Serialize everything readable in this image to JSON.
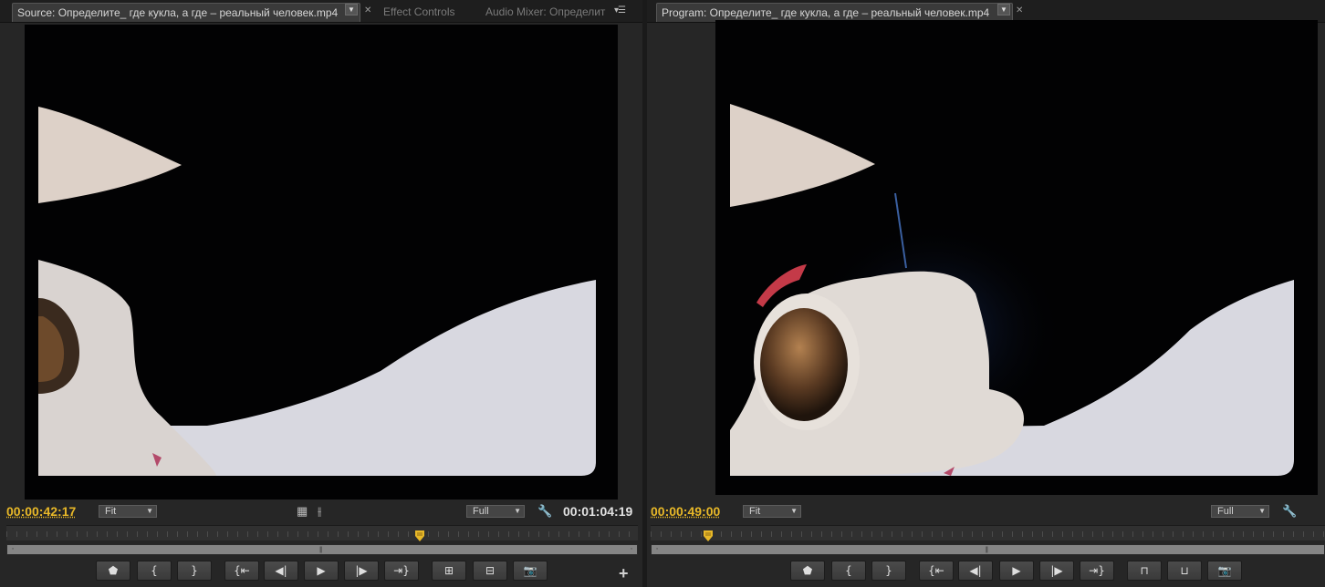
{
  "source": {
    "tabs": [
      {
        "label": "Source: Определите_ где кукла, а где – реальный человек.mp4",
        "active": true
      },
      {
        "label": "Effect Controls",
        "active": false
      },
      {
        "label": "Audio Mixer: Определит",
        "active": false
      }
    ],
    "current_timecode": "00:00:42:17",
    "duration_timecode": "00:01:04:19",
    "zoom_select": "Fit",
    "resolution_select": "Full",
    "playhead_progress": 0.655,
    "buttons": [
      {
        "name": "add-marker",
        "icon": "marker-icon",
        "glyph": "⬟"
      },
      {
        "name": "mark-in",
        "icon": "mark-in-icon",
        "glyph": "{"
      },
      {
        "name": "mark-out",
        "icon": "mark-out-icon",
        "glyph": "}"
      },
      {
        "name": "go-to-in",
        "icon": "go-to-in-icon",
        "glyph": "{⇤"
      },
      {
        "name": "step-back",
        "icon": "step-back-icon",
        "glyph": "◀|"
      },
      {
        "name": "play",
        "icon": "play-icon",
        "glyph": "▶"
      },
      {
        "name": "step-forward",
        "icon": "step-forward-icon",
        "glyph": "|▶"
      },
      {
        "name": "go-to-out",
        "icon": "go-to-out-icon",
        "glyph": "⇥}"
      },
      {
        "name": "insert",
        "icon": "insert-icon",
        "glyph": "⊞"
      },
      {
        "name": "overwrite",
        "icon": "overwrite-icon",
        "glyph": "⊟"
      },
      {
        "name": "export-frame",
        "icon": "camera-icon",
        "glyph": "📷"
      }
    ]
  },
  "program": {
    "tabs": [
      {
        "label": "Program: Определите_ где кукла, а где – реальный человек.mp4",
        "active": true
      }
    ],
    "current_timecode": "00:00:49:00",
    "zoom_select": "Fit",
    "resolution_select": "Full",
    "playhead_progress": 0.085,
    "buttons": [
      {
        "name": "add-marker",
        "icon": "marker-icon",
        "glyph": "⬟"
      },
      {
        "name": "mark-in",
        "icon": "mark-in-icon",
        "glyph": "{"
      },
      {
        "name": "mark-out",
        "icon": "mark-out-icon",
        "glyph": "}"
      },
      {
        "name": "go-to-in",
        "icon": "go-to-in-icon",
        "glyph": "{⇤"
      },
      {
        "name": "step-back",
        "icon": "step-back-icon",
        "glyph": "◀|"
      },
      {
        "name": "play",
        "icon": "play-icon",
        "glyph": "▶"
      },
      {
        "name": "step-forward",
        "icon": "step-forward-icon",
        "glyph": "|▶"
      },
      {
        "name": "go-to-out",
        "icon": "go-to-out-icon",
        "glyph": "⇥}"
      },
      {
        "name": "lift",
        "icon": "lift-icon",
        "glyph": "⊓"
      },
      {
        "name": "extract",
        "icon": "extract-icon",
        "glyph": "⊔"
      },
      {
        "name": "export-frame",
        "icon": "camera-icon",
        "glyph": "📷"
      }
    ]
  },
  "colors": {
    "timecode_current": "#e8b828",
    "timecode_duration": "#e2e2e2",
    "playhead": "#e8b828"
  }
}
